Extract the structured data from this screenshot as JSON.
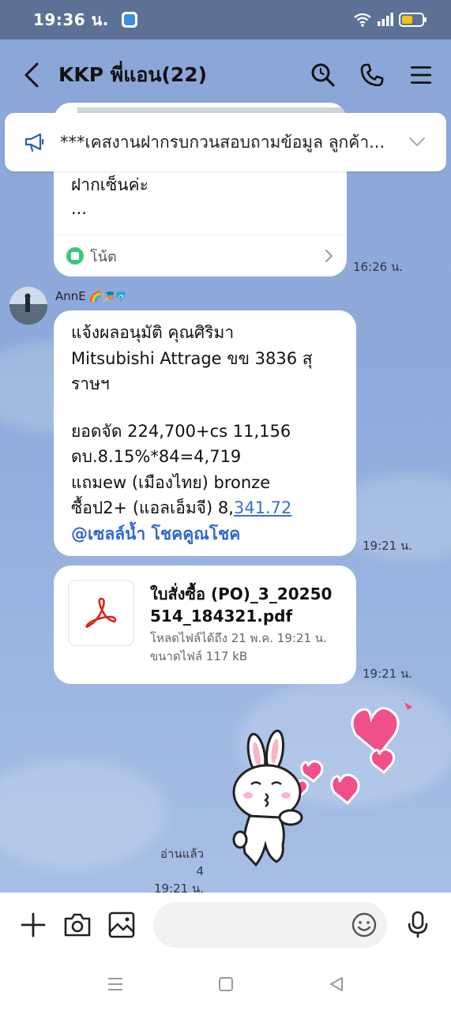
{
  "status_bar": {
    "time": "19:36 น."
  },
  "header": {
    "title": "KKP พี่แอน(22)"
  },
  "announcement": {
    "text": "***เคสงานฝากรบกวนสอบถามข้อมูล ลูกค้า..."
  },
  "messages": {
    "note": {
      "line1": "ฝากเซ็นค่ะ",
      "line2": "...",
      "footer_label": "โน้ต",
      "time": "16:26 น."
    },
    "sender": {
      "name": "AnnE",
      "emoji": "🌈🎏🐬"
    },
    "text_message": {
      "lines": [
        "แจ้งผลอนุมัติ คุณศิริมา",
        "Mitsubishi Attrage ขข 3836 สุ",
        "ราษฯ",
        "ยอดจัด 224,700+cs 11,156",
        "ดบ.8.15%*84=4,719",
        "แถมew (เมืองไทย) bronze",
        "ซื้อป2+ (แอลเอ็มจี) 8,",
        "341.72",
        "@เซลล์น้ำ โชคคูณโชค"
      ],
      "time": "19:21 น."
    },
    "file_message": {
      "name_line1": "ใบสั่งซื้อ (PO)_3_20250",
      "name_line2": "514_184321.pdf",
      "download_info": "โหลดไฟล์ได้ถึง 21 พ.ค. 19:21 น.",
      "size_info": "ขนาดไฟล์ 117 kB",
      "time": "19:21 น."
    },
    "sticker": {
      "read_label": "อ่านแล้ว 4",
      "time": "19:21 น."
    }
  },
  "input": {
    "value": "",
    "placeholder": ""
  },
  "colors": {
    "chat_background": "#8da9da",
    "status_bar": "#5d7196",
    "link": "#3a6fd0",
    "pdf_red": "#d9261c",
    "note_green": "#3cc57a"
  }
}
